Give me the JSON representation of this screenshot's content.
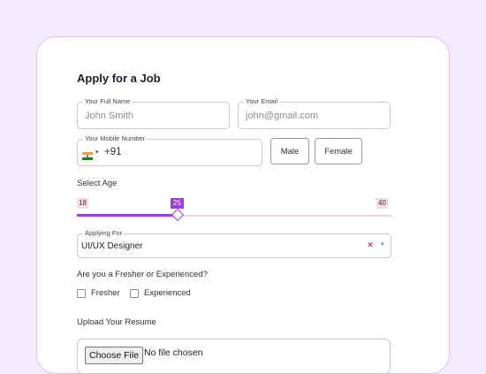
{
  "form": {
    "title": "Apply for a Job",
    "full_name": {
      "label": "Your Full Name",
      "placeholder": "John Smith"
    },
    "email": {
      "label": "Your Email",
      "placeholder": "john@gmail.com"
    },
    "mobile": {
      "label": "Your Mobile Number",
      "country_code": "+91",
      "flag": "india-flag-icon"
    },
    "gender_buttons": [
      "Male",
      "Female"
    ],
    "age": {
      "label": "Select Age",
      "min": "18",
      "max": "40",
      "value": "25",
      "value_fraction": 0.318
    },
    "applying_for": {
      "label": "Applying For",
      "value": "UI/UX Designer"
    },
    "experience": {
      "question": "Are you a Fresher or Experienced?",
      "options": [
        "Fresher",
        "Experienced"
      ]
    },
    "resume": {
      "label": "Upload Your Resume",
      "button": "Choose File",
      "status": "No file chosen"
    }
  },
  "colors": {
    "background": "#f3eafd",
    "accent": "#9b3fe0",
    "card_border": "#d9c2f2",
    "clear_icon": "#e0264a"
  }
}
